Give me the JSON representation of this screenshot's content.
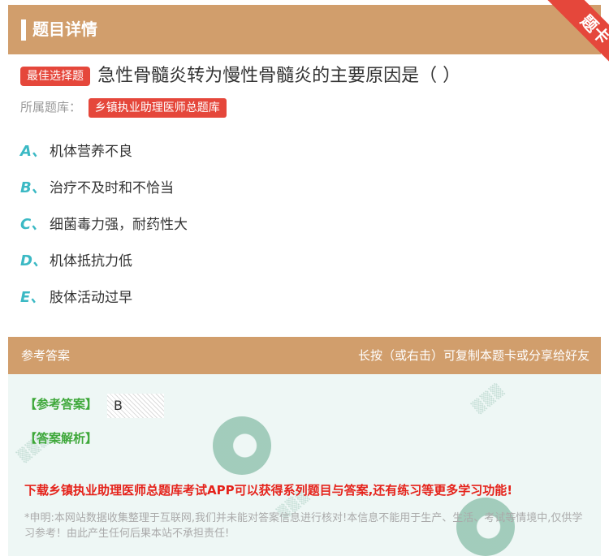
{
  "header": {
    "title": "题目详情",
    "ribbon": "题卡"
  },
  "question": {
    "tag": "最佳选择题",
    "text": "急性骨髓炎转为慢性骨髓炎的主要原因是（ ）",
    "bank_label": "所属题库：",
    "bank_name": "乡镇执业助理医师总题库"
  },
  "options": [
    {
      "letter": "A、",
      "text": "机体营养不良"
    },
    {
      "letter": "B、",
      "text": "治疗不及时和不恰当"
    },
    {
      "letter": "C、",
      "text": "细菌毒力强，耐药性大"
    },
    {
      "letter": "D、",
      "text": "机体抵抗力低"
    },
    {
      "letter": "E、",
      "text": "肢体活动过早"
    }
  ],
  "answer_section": {
    "title": "参考答案",
    "hint": "长按（或右击）可复制本题卡或分享给好友",
    "answer_label": "【参考答案】",
    "answer_value": "B",
    "analysis_label": "【答案解析】",
    "promo": "下载乡镇执业助理医师总题库考试APP可以获得系列题目与答案,还有练习等更多学习功能!",
    "disclaimer": "*申明:本网站数据收集整理于互联网,我们并未能对答案信息进行核对!本信息不能用于生产、生活、考试等情境中,仅供学习参考！由此产生任何后果本站不承担责任!"
  },
  "colors": {
    "header_bg": "#d19e6c",
    "tag_red": "#e5473b",
    "option_letter": "#3bb9c4",
    "answer_green": "#3ea83a",
    "promo_red": "#e5231b",
    "answer_bg": "#eef7f5"
  }
}
